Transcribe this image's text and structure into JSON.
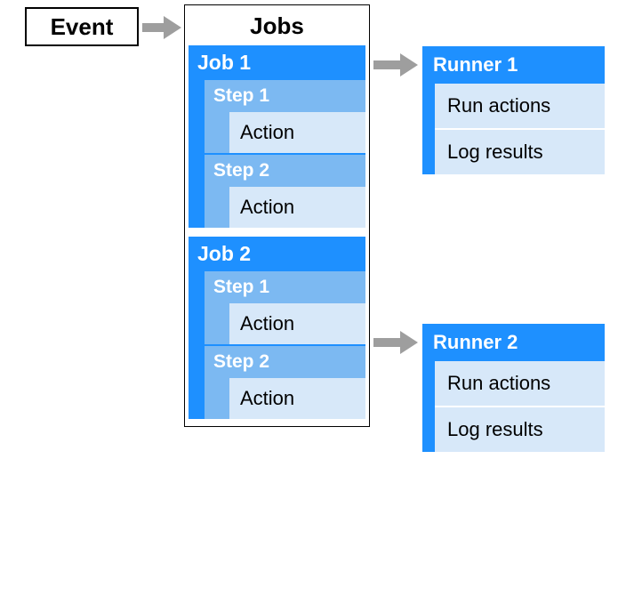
{
  "event": {
    "label": "Event"
  },
  "jobs": {
    "title": "Jobs",
    "items": [
      {
        "title": "Job 1",
        "steps": [
          {
            "title": "Step 1",
            "action": "Action"
          },
          {
            "title": "Step 2",
            "action": "Action"
          }
        ]
      },
      {
        "title": "Job 2",
        "steps": [
          {
            "title": "Step 1",
            "action": "Action"
          },
          {
            "title": "Step 2",
            "action": "Action"
          }
        ]
      }
    ]
  },
  "runners": [
    {
      "title": "Runner 1",
      "items": [
        "Run actions",
        "Log results"
      ]
    },
    {
      "title": "Runner 2",
      "items": [
        "Run actions",
        "Log results"
      ]
    }
  ],
  "colors": {
    "primary": "#1e90ff",
    "mid": "#7cb9f2",
    "light": "#d7e8f9",
    "arrow": "#9e9e9e"
  }
}
